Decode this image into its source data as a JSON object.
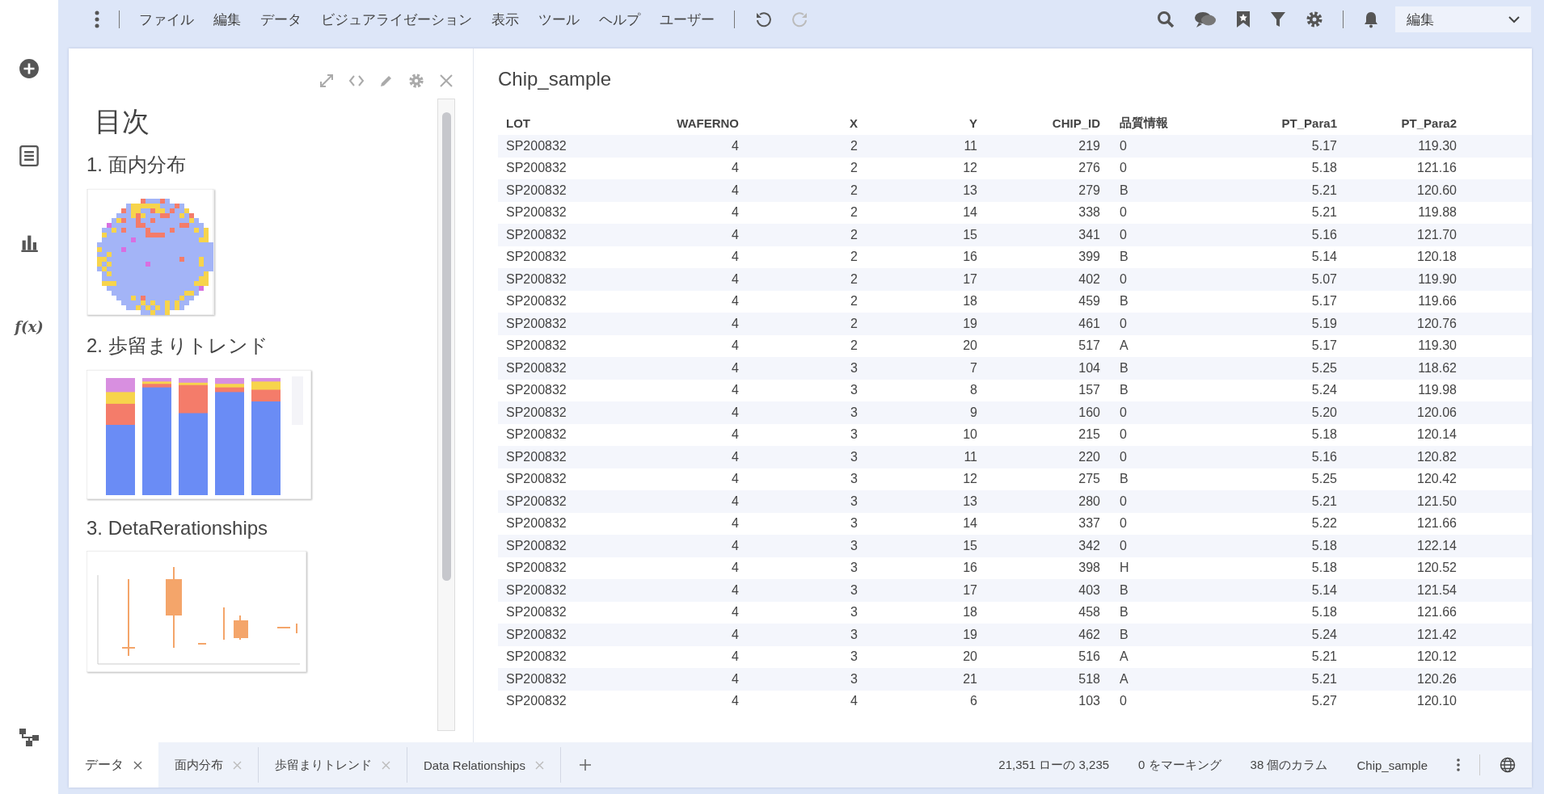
{
  "rail": {
    "fx_label": "f(x)"
  },
  "menubar": {
    "items": [
      "ファイル",
      "編集",
      "データ",
      "ビジュアライゼーション",
      "表示",
      "ツール",
      "ヘルプ",
      "ユーザー"
    ],
    "undo_disabled": false,
    "redo_disabled": true,
    "mode": "編集"
  },
  "toc": {
    "title": "目次",
    "sections": [
      {
        "heading": "1. 面内分布",
        "kind": "wafer"
      },
      {
        "heading": "2. 歩留まりトレンド",
        "kind": "bars"
      },
      {
        "heading": "3. DetaRerationships",
        "kind": "boxplot"
      }
    ]
  },
  "table": {
    "title": "Chip_sample",
    "columns": [
      "LOT",
      "WAFERNO",
      "X",
      "Y",
      "CHIP_ID",
      "品質情報",
      "PT_Para1",
      "PT_Para2"
    ],
    "rows": [
      [
        "SP200832",
        "4",
        "2",
        "11",
        "219",
        "0",
        "5.17",
        "119.30"
      ],
      [
        "SP200832",
        "4",
        "2",
        "12",
        "276",
        "0",
        "5.18",
        "121.16"
      ],
      [
        "SP200832",
        "4",
        "2",
        "13",
        "279",
        "B",
        "5.21",
        "120.60"
      ],
      [
        "SP200832",
        "4",
        "2",
        "14",
        "338",
        "0",
        "5.21",
        "119.88"
      ],
      [
        "SP200832",
        "4",
        "2",
        "15",
        "341",
        "0",
        "5.16",
        "121.70"
      ],
      [
        "SP200832",
        "4",
        "2",
        "16",
        "399",
        "B",
        "5.14",
        "120.18"
      ],
      [
        "SP200832",
        "4",
        "2",
        "17",
        "402",
        "0",
        "5.07",
        "119.90"
      ],
      [
        "SP200832",
        "4",
        "2",
        "18",
        "459",
        "B",
        "5.17",
        "119.66"
      ],
      [
        "SP200832",
        "4",
        "2",
        "19",
        "461",
        "0",
        "5.19",
        "120.76"
      ],
      [
        "SP200832",
        "4",
        "2",
        "20",
        "517",
        "A",
        "5.17",
        "119.30"
      ],
      [
        "SP200832",
        "4",
        "3",
        "7",
        "104",
        "B",
        "5.25",
        "118.62"
      ],
      [
        "SP200832",
        "4",
        "3",
        "8",
        "157",
        "B",
        "5.24",
        "119.98"
      ],
      [
        "SP200832",
        "4",
        "3",
        "9",
        "160",
        "0",
        "5.20",
        "120.06"
      ],
      [
        "SP200832",
        "4",
        "3",
        "10",
        "215",
        "0",
        "5.18",
        "120.14"
      ],
      [
        "SP200832",
        "4",
        "3",
        "11",
        "220",
        "0",
        "5.16",
        "120.82"
      ],
      [
        "SP200832",
        "4",
        "3",
        "12",
        "275",
        "B",
        "5.25",
        "120.42"
      ],
      [
        "SP200832",
        "4",
        "3",
        "13",
        "280",
        "0",
        "5.21",
        "121.50"
      ],
      [
        "SP200832",
        "4",
        "3",
        "14",
        "337",
        "0",
        "5.22",
        "121.66"
      ],
      [
        "SP200832",
        "4",
        "3",
        "15",
        "342",
        "0",
        "5.18",
        "122.14"
      ],
      [
        "SP200832",
        "4",
        "3",
        "16",
        "398",
        "H",
        "5.18",
        "120.52"
      ],
      [
        "SP200832",
        "4",
        "3",
        "17",
        "403",
        "B",
        "5.14",
        "121.54"
      ],
      [
        "SP200832",
        "4",
        "3",
        "18",
        "458",
        "B",
        "5.18",
        "121.66"
      ],
      [
        "SP200832",
        "4",
        "3",
        "19",
        "462",
        "B",
        "5.24",
        "121.42"
      ],
      [
        "SP200832",
        "4",
        "3",
        "20",
        "516",
        "A",
        "5.21",
        "120.12"
      ],
      [
        "SP200832",
        "4",
        "3",
        "21",
        "518",
        "A",
        "5.21",
        "120.26"
      ],
      [
        "SP200832",
        "4",
        "4",
        "6",
        "103",
        "0",
        "5.27",
        "120.10"
      ]
    ]
  },
  "page_tabs": [
    {
      "label": "データ",
      "selected": true
    },
    {
      "label": "面内分布",
      "selected": false
    },
    {
      "label": "歩留まりトレンド",
      "selected": false
    },
    {
      "label": "Data Relationships",
      "selected": false
    }
  ],
  "status": {
    "rows": "21,351 ローの 3,235",
    "marked": "0 をマーキング",
    "columns": "38 個のカラム",
    "table": "Chip_sample"
  }
}
